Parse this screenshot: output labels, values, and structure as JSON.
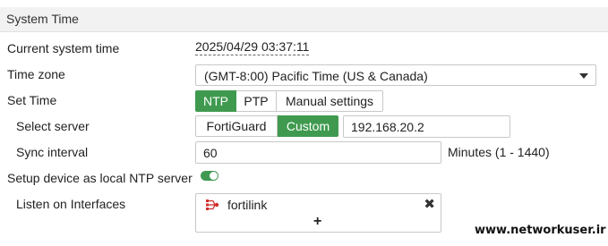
{
  "section": {
    "title": "System Time"
  },
  "current_time": {
    "label": "Current system time",
    "value": "2025/04/29 03:37:11"
  },
  "timezone": {
    "label": "Time zone",
    "selected": "(GMT-8:00) Pacific Time (US & Canada)"
  },
  "set_time": {
    "label": "Set Time",
    "options": [
      "NTP",
      "PTP",
      "Manual settings"
    ],
    "selected": "NTP"
  },
  "select_server": {
    "label": "Select server",
    "options": [
      "FortiGuard",
      "Custom"
    ],
    "selected": "Custom",
    "server_value": "192.168.20.2"
  },
  "sync_interval": {
    "label": "Sync interval",
    "value": "60",
    "hint": "Minutes (1 - 1440)"
  },
  "local_ntp": {
    "label": "Setup device as local NTP server",
    "enabled": true
  },
  "listen_interfaces": {
    "label": "Listen on Interfaces",
    "items": [
      {
        "name": "fortilink",
        "icon": "fortilink-icon"
      }
    ],
    "add_label": "+"
  },
  "watermark": "www.networkuser.ir",
  "colors": {
    "accent": "#3f9a4f",
    "icon_red": "#d0312d"
  }
}
